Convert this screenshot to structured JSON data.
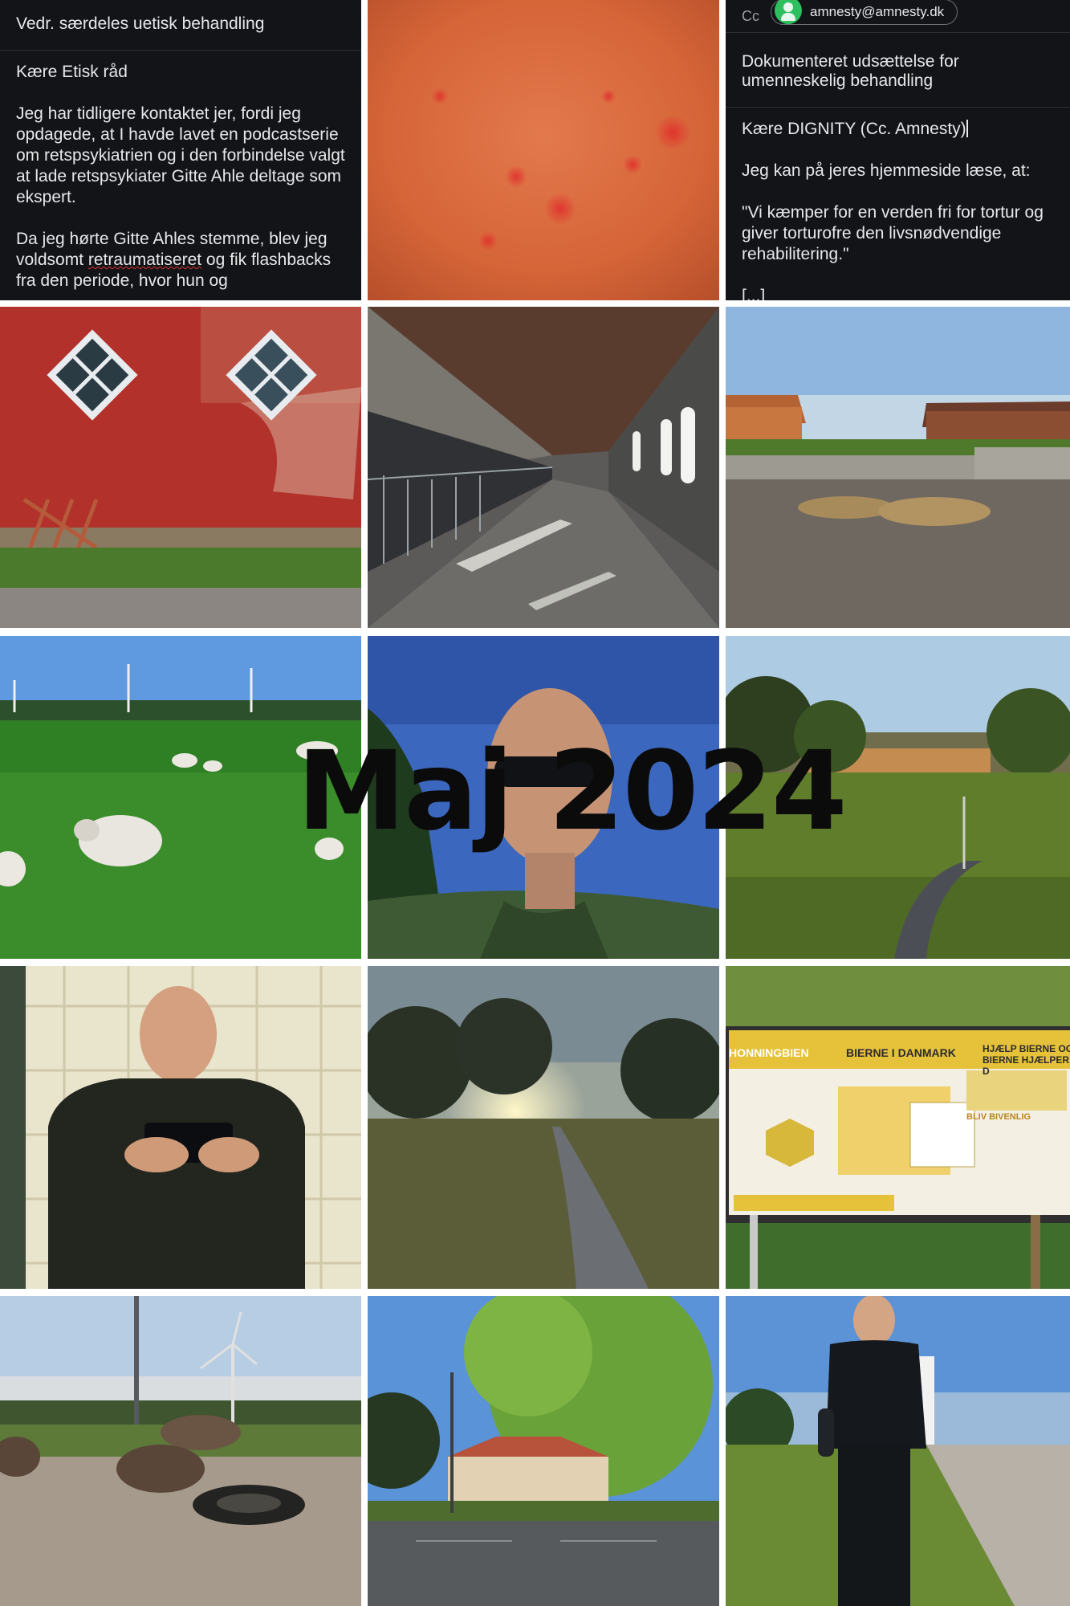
{
  "email_left": {
    "subject": "Vedr. særdeles uetisk behandling",
    "greeting": "Kære Etisk råd",
    "paragraph1": "Jeg har tidligere kontaktet jer, fordi jeg opdagede, at I havde lavet en podcastserie om retspsykiatrien og i den forbindelse valgt at lade retspsykiater Gitte Ahle deltage som ekspert.",
    "paragraph2_start": "Da jeg hørte Gitte Ahles stemme, blev jeg voldsomt ",
    "paragraph2_flagged": "retraumatiseret",
    "paragraph2_end": " og fik flashbacks fra den periode, hvor hun og"
  },
  "email_right": {
    "cc_label": "Cc",
    "cc_email": "amnesty@amnesty.dk",
    "subject": "Dokumenteret udsættelse for umenneskelig behandling",
    "greeting": "Kære DIGNITY (Cc. Amnesty)",
    "paragraph1": "Jeg kan på jeres hjemmeside læse, at:",
    "quote": "\"Vi kæmper for en verden fri for tortur og giver torturofre den livsnødvendige rehabilitering.\"",
    "ellipsis": "[...]"
  },
  "overlay_title": "Maj 2024",
  "sign": {
    "heading_left": "HONNINGBIEN",
    "heading_mid": "BIERNE I DANMARK",
    "heading_right": "HJÆLP BIERNE OG BIERNE HJÆLPER D",
    "section": "BLIV BIVENLIG"
  },
  "colors": {
    "email_bg": "#121417",
    "accent_green": "#2fbf5f",
    "title": "#0b0b0b"
  }
}
